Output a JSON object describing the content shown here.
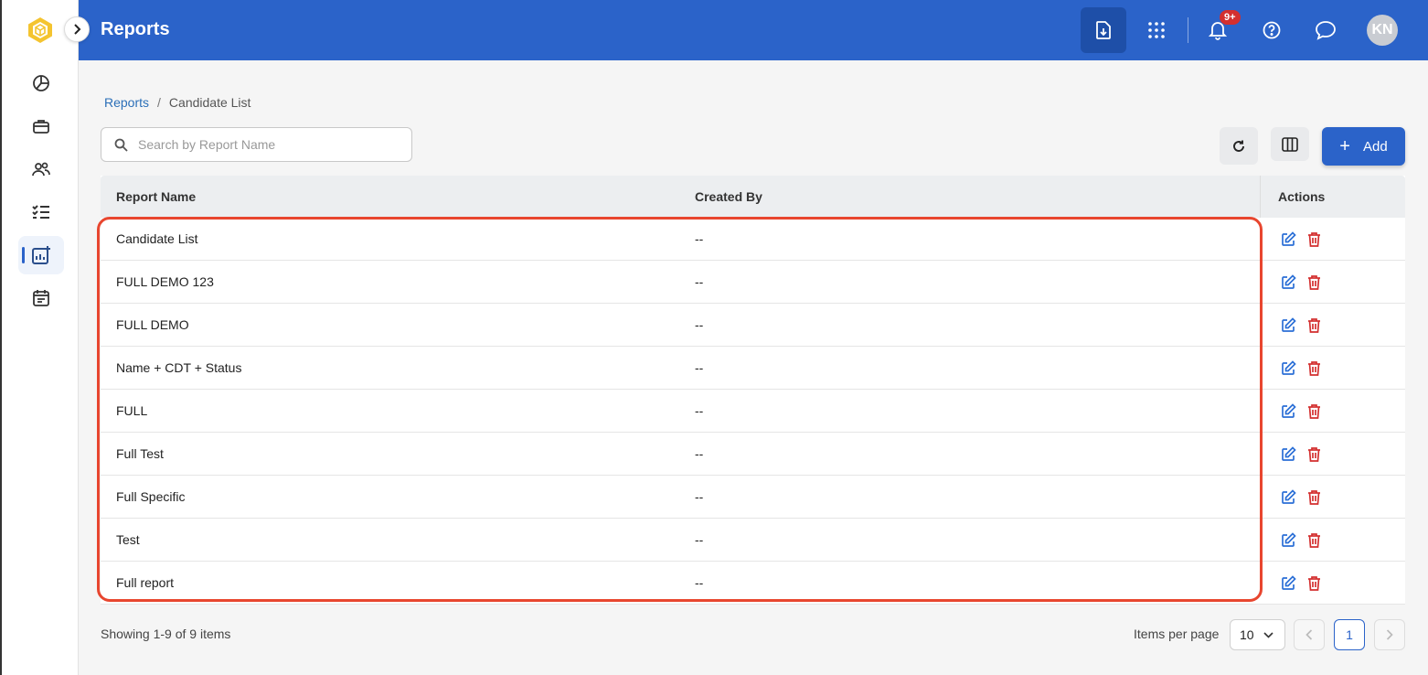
{
  "header": {
    "title": "Reports",
    "notification_badge": "9+",
    "avatar_initials": "KN",
    "bg_color": "#2b63c9"
  },
  "sidebar": {
    "items": [
      {
        "icon": "dashboard-pie-icon"
      },
      {
        "icon": "briefcase-icon"
      },
      {
        "icon": "users-icon"
      },
      {
        "icon": "checklist-icon"
      },
      {
        "icon": "reports-chart-icon",
        "active": true
      },
      {
        "icon": "calendar-icon"
      }
    ]
  },
  "breadcrumb": {
    "parent": "Reports",
    "separator": "/",
    "current": "Candidate List"
  },
  "search": {
    "placeholder": "Search by Report Name",
    "value": ""
  },
  "toolbar": {
    "add_label": "Add"
  },
  "table": {
    "columns": [
      "Report Name",
      "Created By",
      "Actions"
    ],
    "rows": [
      {
        "name": "Candidate List",
        "created_by": "--"
      },
      {
        "name": "FULL DEMO 123",
        "created_by": "--"
      },
      {
        "name": "FULL DEMO",
        "created_by": "--"
      },
      {
        "name": "Name + CDT + Status",
        "created_by": "--"
      },
      {
        "name": "FULL",
        "created_by": "--"
      },
      {
        "name": "Full Test",
        "created_by": "--"
      },
      {
        "name": "Full Specific",
        "created_by": "--"
      },
      {
        "name": "Test",
        "created_by": "--"
      },
      {
        "name": "Full report",
        "created_by": "--"
      }
    ]
  },
  "footer": {
    "showing": "Showing 1-9 of 9 items",
    "items_per_page_label": "Items per page",
    "items_per_page": "10",
    "current_page": "1"
  },
  "colors": {
    "primary": "#2b63c9",
    "edit": "#2b6fd6",
    "delete": "#d32f2f",
    "highlight": "#e8462f"
  }
}
